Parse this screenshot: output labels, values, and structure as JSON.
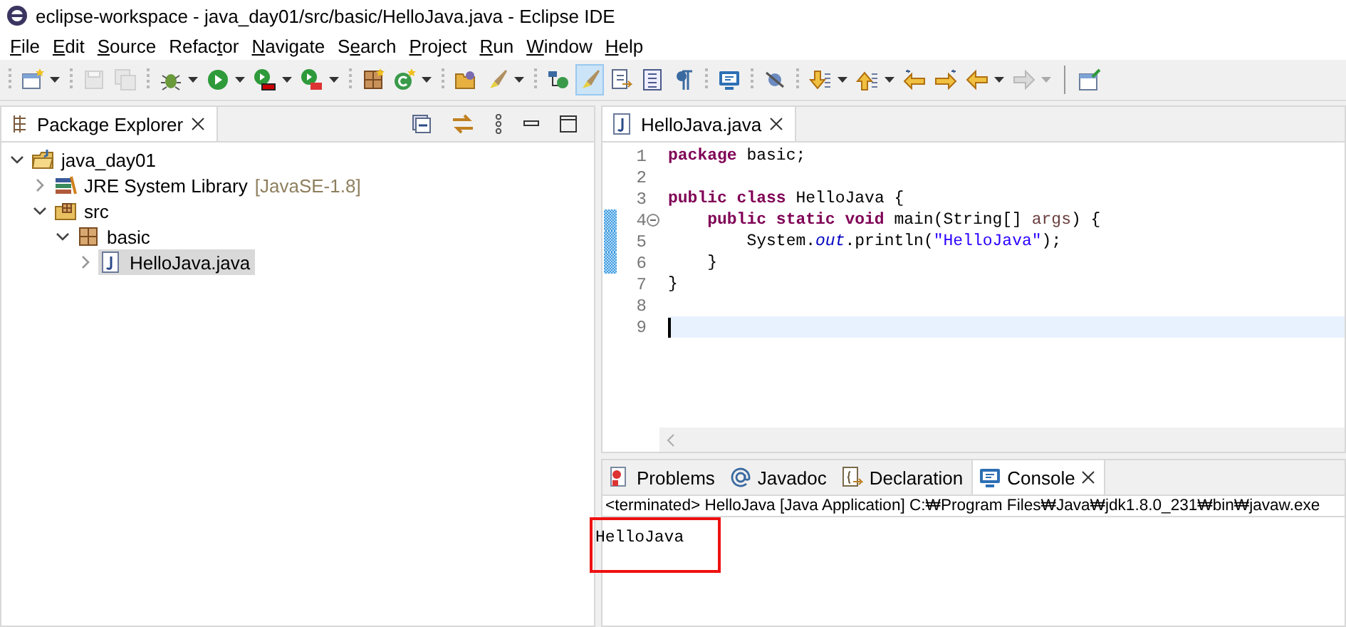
{
  "window": {
    "title": "eclipse-workspace - java_day01/src/basic/HelloJava.java - Eclipse IDE"
  },
  "menu": [
    {
      "mnemonic": "F",
      "after": "ile"
    },
    {
      "mnemonic": "E",
      "after": "dit"
    },
    {
      "mnemonic": "S",
      "after": "ource"
    },
    {
      "before": "Refac",
      "mnemonic": "t",
      "after": "or"
    },
    {
      "mnemonic": "N",
      "after": "avigate"
    },
    {
      "before": "S",
      "mnemonic": "e",
      "after": "arch"
    },
    {
      "mnemonic": "P",
      "after": "roject"
    },
    {
      "mnemonic": "R",
      "after": "un"
    },
    {
      "mnemonic": "W",
      "after": "indow"
    },
    {
      "mnemonic": "H",
      "after": "elp"
    }
  ],
  "toolbar": [
    {
      "kind": "new",
      "dropdown": true,
      "disabled": false,
      "pressed": false
    },
    {
      "kind": "separator"
    },
    {
      "kind": "save",
      "dropdown": false,
      "disabled": true,
      "pressed": false
    },
    {
      "kind": "save-all",
      "dropdown": false,
      "disabled": true,
      "pressed": false
    },
    {
      "kind": "separator"
    },
    {
      "kind": "debug",
      "dropdown": true,
      "disabled": false,
      "pressed": false
    },
    {
      "kind": "run",
      "dropdown": true,
      "disabled": false,
      "pressed": false
    },
    {
      "kind": "coverage",
      "dropdown": true,
      "disabled": false,
      "pressed": false
    },
    {
      "kind": "external",
      "dropdown": true,
      "disabled": false,
      "pressed": false
    },
    {
      "kind": "separator"
    },
    {
      "kind": "package",
      "dropdown": false,
      "disabled": false,
      "pressed": false
    },
    {
      "kind": "class",
      "dropdown": true,
      "disabled": false,
      "pressed": false
    },
    {
      "kind": "separator"
    },
    {
      "kind": "folder",
      "dropdown": false,
      "disabled": false,
      "pressed": false
    },
    {
      "kind": "brush",
      "dropdown": true,
      "disabled": false,
      "pressed": false
    },
    {
      "kind": "separator"
    },
    {
      "kind": "hierarchy",
      "dropdown": false,
      "disabled": false,
      "pressed": false
    },
    {
      "kind": "brush",
      "dropdown": false,
      "disabled": false,
      "pressed": true
    },
    {
      "kind": "edit",
      "dropdown": false,
      "disabled": false,
      "pressed": false
    },
    {
      "kind": "list",
      "dropdown": false,
      "disabled": false,
      "pressed": false
    },
    {
      "kind": "pilcrow",
      "dropdown": false,
      "disabled": false,
      "pressed": false
    },
    {
      "kind": "separator"
    },
    {
      "kind": "monitor",
      "dropdown": false,
      "disabled": false,
      "pressed": false
    },
    {
      "kind": "separator"
    },
    {
      "kind": "skip",
      "dropdown": false,
      "disabled": false,
      "pressed": false
    },
    {
      "kind": "separator"
    },
    {
      "kind": "down",
      "dropdown": true,
      "disabled": false,
      "pressed": false
    },
    {
      "kind": "up",
      "dropdown": true,
      "disabled": false,
      "pressed": false
    },
    {
      "kind": "left-star",
      "dropdown": false,
      "disabled": false,
      "pressed": false
    },
    {
      "kind": "right-star",
      "dropdown": false,
      "disabled": false,
      "pressed": false
    },
    {
      "kind": "left",
      "dropdown": true,
      "disabled": false,
      "pressed": false
    },
    {
      "kind": "right",
      "dropdown": true,
      "disabled": true,
      "pressed": false
    },
    {
      "kind": "bar"
    },
    {
      "kind": "perspective",
      "dropdown": false,
      "disabled": false,
      "pressed": false
    }
  ],
  "explorer": {
    "title": "Package Explorer",
    "tree": [
      {
        "kind": "project",
        "label": "java_day01",
        "expanded": true,
        "selected": false,
        "children": [
          {
            "kind": "library",
            "label": "JRE System Library",
            "decoration": "[JavaSE-1.8]",
            "expanded": false,
            "selected": false
          },
          {
            "kind": "source-folder",
            "label": "src",
            "expanded": true,
            "selected": false,
            "children": [
              {
                "kind": "package",
                "label": "basic",
                "expanded": true,
                "selected": false,
                "children": [
                  {
                    "kind": "java-file",
                    "label": "HelloJava.java",
                    "expanded": false,
                    "selected": true
                  }
                ]
              }
            ]
          }
        ]
      }
    ]
  },
  "editor": {
    "tab": "HelloJava.java",
    "lines": [
      {
        "number": "1",
        "changed": false,
        "current": false,
        "fold": false,
        "tokens": [
          {
            "kind": "keyword",
            "text": "package"
          },
          {
            "kind": "plain",
            "text": " basic;"
          }
        ]
      },
      {
        "number": "2",
        "changed": false,
        "current": false,
        "fold": false
      },
      {
        "number": "3",
        "changed": false,
        "current": false,
        "fold": false,
        "tokens": [
          {
            "kind": "keyword",
            "text": "public class"
          },
          {
            "kind": "plain",
            "text": " HelloJava {"
          }
        ]
      },
      {
        "number": "4",
        "changed": true,
        "current": false,
        "fold": true,
        "tokens": [
          {
            "kind": "keyword",
            "text": "    public static void"
          },
          {
            "kind": "plain",
            "text": " main(String[] "
          },
          {
            "kind": "param",
            "text": "args"
          },
          {
            "kind": "plain",
            "text": ") {"
          }
        ]
      },
      {
        "number": "5",
        "changed": true,
        "current": false,
        "fold": false,
        "tokens": [
          {
            "kind": "plain",
            "text": "        System."
          },
          {
            "kind": "field",
            "text": "out"
          },
          {
            "kind": "plain",
            "text": ".println("
          },
          {
            "kind": "string",
            "text": "\"HelloJava\""
          },
          {
            "kind": "plain",
            "text": ");"
          }
        ]
      },
      {
        "number": "6",
        "changed": true,
        "current": false,
        "fold": false,
        "tokens": [
          {
            "kind": "plain",
            "text": "    }"
          }
        ]
      },
      {
        "number": "7",
        "changed": false,
        "current": false,
        "fold": false,
        "tokens": [
          {
            "kind": "plain",
            "text": "}"
          }
        ]
      },
      {
        "number": "8",
        "changed": false,
        "current": false,
        "fold": false
      },
      {
        "number": "9",
        "changed": false,
        "current": true,
        "fold": false
      }
    ]
  },
  "bottom": {
    "tabs": [
      {
        "kind": "problems",
        "label": "Problems",
        "selected": false
      },
      {
        "kind": "javadoc",
        "label": "Javadoc",
        "selected": false
      },
      {
        "kind": "declaration",
        "label": "Declaration",
        "selected": false
      },
      {
        "kind": "console",
        "label": "Console",
        "selected": true
      }
    ],
    "console": {
      "status": "<terminated> HelloJava [Java Application] C:₩Program Files₩Java₩jdk1.8.0_231₩bin₩javaw.exe",
      "output": "HelloJava",
      "highlighted": true
    }
  }
}
